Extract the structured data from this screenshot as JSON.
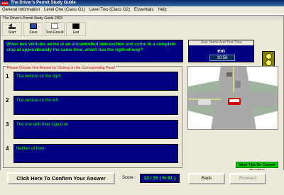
{
  "window": {
    "title": "The Driver's Permit Study Guide",
    "icon_label": "DSG"
  },
  "menu": [
    "General Information",
    "Level One (Class G1)",
    "Level Two (Class G2)",
    "Essentials",
    "Help"
  ],
  "toolwindow": {
    "title": "The Driver's Permit Study Guide 2003"
  },
  "toolbar": [
    {
      "label": "Start",
      "icon": "start-icon"
    },
    {
      "label": "Save",
      "icon": "save-icon"
    },
    {
      "label": "Test Result",
      "icon": "test-result-icon"
    },
    {
      "label": "Exit",
      "icon": "exit-icon"
    }
  ],
  "question": "When two vehicles arrive at an uncontrolled intersection and come to a complete stop at approximately the same time, which has the right-of-way?",
  "user": {
    "caption": "User Name And Test Time",
    "name": "em",
    "time": "10:56"
  },
  "answers": {
    "caption": "Please Choose One Answer by Clicking on the Corresponding Panel",
    "items": [
      {
        "num": "1",
        "text": "The vehicle on the right"
      },
      {
        "num": "2",
        "text": "The vehicle on the left"
      },
      {
        "num": "3",
        "text": "The one with their signal on"
      },
      {
        "num": "4",
        "text": "Neither of them"
      }
    ]
  },
  "tips_label": "More Tips On Current Question",
  "bottom": {
    "confirm": "Click Here To Confirm Your Answer",
    "score_label": "Score :",
    "score_value": "32 / 35  ( % 91 )",
    "back": "Back",
    "forward": "Forward"
  },
  "colors": {
    "panel_bg": "#000080",
    "panel_text": "#00ff00",
    "traffic_bg": "#808000",
    "lamp": "#ffff66"
  }
}
